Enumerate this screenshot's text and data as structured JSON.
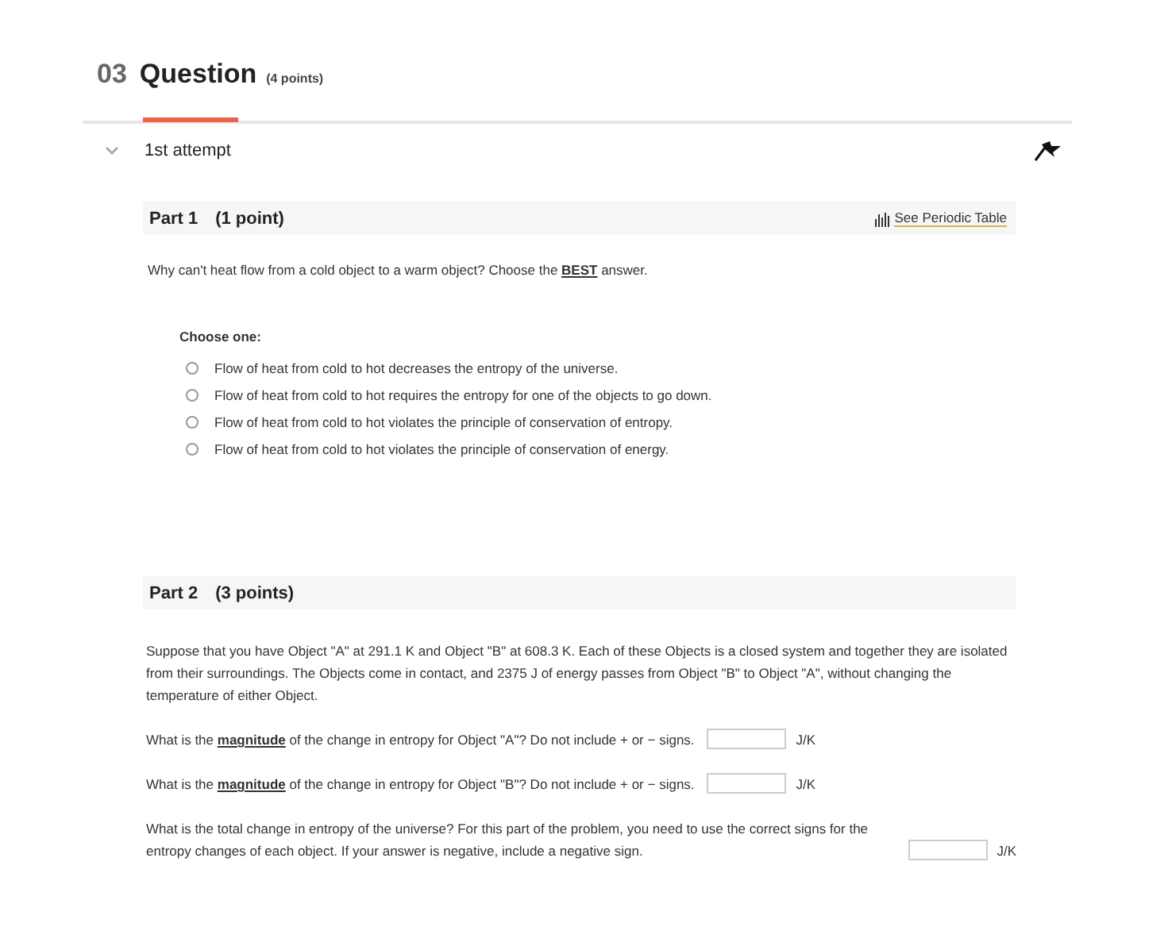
{
  "question": {
    "number": "03",
    "title": "Question",
    "points": "(4 points)"
  },
  "attempt": {
    "label": "1st attempt",
    "expanded": true
  },
  "parts": [
    {
      "kind": "choice",
      "title": "Part 1",
      "points": "(1 point)",
      "link": "See Periodic Table",
      "prompt": "Why can't heat flow from a cold object to a warm object? Choose the **BEST** answer.",
      "choose_label": "Choose one:",
      "choices": [
        {
          "label": "Flow of heat from cold to hot decreases the entropy of the universe.",
          "selected": false
        },
        {
          "label": "Flow of heat from cold to hot requires the entropy for one of the objects to go down.",
          "selected": false
        },
        {
          "label": "Flow of heat from cold to hot violates the principle of conservation of entropy.",
          "selected": false
        },
        {
          "label": "Flow of heat from cold to hot violates the principle of conservation of energy.",
          "selected": false
        }
      ]
    },
    {
      "kind": "entry",
      "title": "Part 2",
      "points": "(3 points)",
      "prompt": "Suppose that you have Object \"A\" at 291.1 K and Object \"B\" at 608.3 K. Each of these Objects is a closed system and together they are isolated from their surroundings. The Objects come in contact, and 2375 J of energy passes from Object \"B\" to Object \"A\", without changing the temperature of either Object.",
      "questions": [
        {
          "text": "What is the **magnitude** of the change in entropy for Object \"A\"? Do not include + or − signs.",
          "unit": "J/K"
        },
        {
          "text": "What is the **magnitude** of the change in entropy for Object \"B\"? Do not include + or − signs.",
          "unit": "J/K"
        },
        {
          "text": "What is the total change in entropy of the universe? For this part of the problem, you need to use the correct signs for the entropy changes of each object. If your answer is negative, include a negative sign.",
          "unit": "J/K"
        }
      ]
    }
  ]
}
